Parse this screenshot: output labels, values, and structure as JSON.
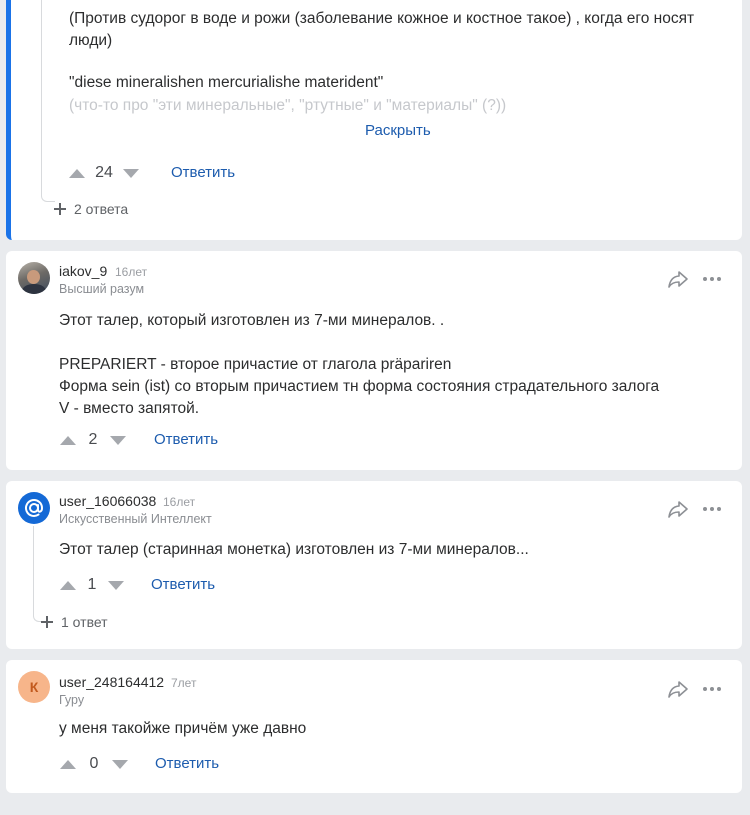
{
  "comment1": {
    "text_lines": [
      "(Против судорог в воде и рожи (заболевание кожное и костное такое) , когда его носят",
      "люди)"
    ],
    "quote": "\"diese mineralishen mercurialishe materident\"",
    "faded": "(что-то про \"эти минеральные\", \"ртутные\" и \"материалы\" (?))",
    "expand_label": "Раскрыть",
    "votes": "24",
    "reply_label": "Ответить",
    "replies_label": "2 ответа"
  },
  "comment2": {
    "username": "iakov_9",
    "age": "16лет",
    "rank": "Высший разум",
    "text": "Этот талер, который изготовлен из 7-ми минералов. .\n\nPREPARIERT - второе причастие от глагола präpariren\nФорма sein (ist) со вторым причастием тн форма состояния страдательного залога\nV - вместо запятой.",
    "votes": "2",
    "reply_label": "Ответить"
  },
  "comment3": {
    "username": "user_16066038",
    "age": "16лет",
    "rank": "Искусственный Интеллект",
    "text": "Этот талер (старинная монетка) изготовлен из 7-ми минералов...",
    "votes": "1",
    "reply_label": "Ответить",
    "replies_label": "1 ответ"
  },
  "comment4": {
    "username": "user_248164412",
    "avatar_letter": "К",
    "age": "7лет",
    "rank": "Гуру",
    "text": "у меня такойже причём уже давно",
    "votes": "0",
    "reply_label": "Ответить"
  },
  "colors": {
    "accent": "#1a73e8",
    "link": "#1d5cae",
    "page_bg": "#e9ebee"
  },
  "icons": [
    "share-icon",
    "more-icon",
    "upvote-icon",
    "downvote-icon",
    "expand-replies-icon",
    "mail-icon"
  ]
}
